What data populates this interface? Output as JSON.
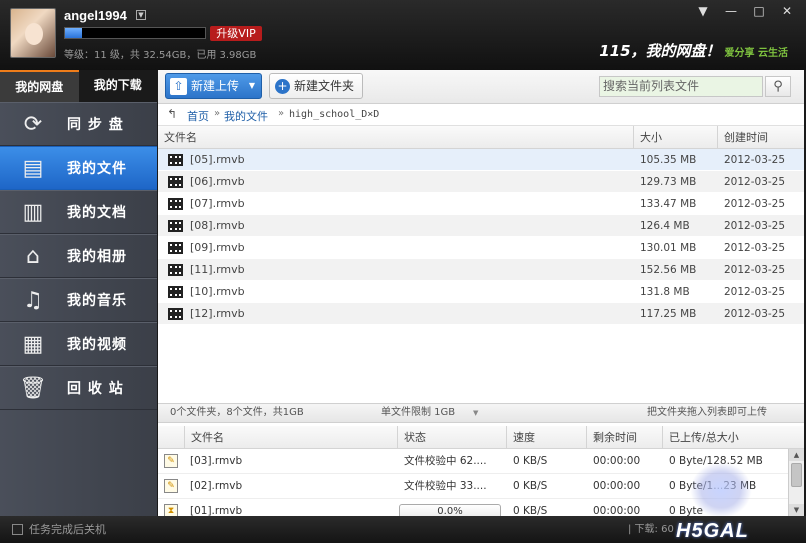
{
  "user": {
    "name": "angel1994",
    "quota_fraction": 0.12,
    "vip_label": "升级VIP",
    "level_info": "等级：11 级，共 32.54GB，已用 3.98GB"
  },
  "brand": {
    "logo": "115，我的网盘！",
    "slogan": "爱分享 云生活"
  },
  "window_controls": {
    "menu": "▼",
    "minimize": "—",
    "maximize": "□",
    "close": "✕"
  },
  "nav_tabs": [
    "我的网盘",
    "我的下载"
  ],
  "sidebar": {
    "items": [
      {
        "label": "同 步 盘",
        "icon": "sync-icon",
        "glyph": "⟳"
      },
      {
        "label": "我的文件",
        "icon": "briefcase-icon",
        "glyph": "▤"
      },
      {
        "label": "我的文档",
        "icon": "document-icon",
        "glyph": "▥"
      },
      {
        "label": "我的相册",
        "icon": "photo-album-icon",
        "glyph": "⌂"
      },
      {
        "label": "我的音乐",
        "icon": "music-note-icon",
        "glyph": "♫"
      },
      {
        "label": "我的视频",
        "icon": "film-icon",
        "glyph": "▦"
      },
      {
        "label": "回 收 站",
        "icon": "trash-icon",
        "glyph": "🗑"
      }
    ],
    "active_index": 1
  },
  "toolbar": {
    "upload_label": "新建上传",
    "newfolder_label": "新建文件夹",
    "search_placeholder": "搜索当前列表文件"
  },
  "breadcrumb": {
    "back": "↰",
    "home": "首页",
    "sep": "»",
    "parent": "我的文件",
    "current": "high_school_D×D"
  },
  "file_columns": {
    "name": "文件名",
    "size": "大小",
    "date": "创建时间"
  },
  "files": [
    {
      "name": "[05].rmvb",
      "size": "105.35 MB",
      "date": "2012-03-25"
    },
    {
      "name": "[06].rmvb",
      "size": "129.73 MB",
      "date": "2012-03-25"
    },
    {
      "name": "[07].rmvb",
      "size": "133.47 MB",
      "date": "2012-03-25"
    },
    {
      "name": "[08].rmvb",
      "size": "126.4 MB",
      "date": "2012-03-25"
    },
    {
      "name": "[09].rmvb",
      "size": "130.01 MB",
      "date": "2012-03-25"
    },
    {
      "name": "[11].rmvb",
      "size": "152.56 MB",
      "date": "2012-03-25"
    },
    {
      "name": "[10].rmvb",
      "size": "131.8 MB",
      "date": "2012-03-25"
    },
    {
      "name": "[12].rmvb",
      "size": "117.25 MB",
      "date": "2012-03-25"
    }
  ],
  "status": {
    "counts": "0个文件夹，8个文件，共1GB",
    "limit": "单文件限制 1GB",
    "hint": "把文件夹拖入列表即可上传"
  },
  "task_columns": {
    "name": "文件名",
    "status": "状态",
    "speed": "速度",
    "remaining": "剩余时间",
    "uploaded": "已上传/总大小"
  },
  "tasks": [
    {
      "name": "[03].rmvb",
      "status": "文件校验中 62....",
      "speed": "0 KB/S",
      "remaining": "00:00:00",
      "uploaded": "0 Byte/128.52 MB"
    },
    {
      "name": "[02].rmvb",
      "status": "文件校验中 33....",
      "speed": "0 KB/S",
      "remaining": "00:00:00",
      "uploaded": "0 Byte/1...23 MB"
    },
    {
      "name": "[01].rmvb",
      "status": "0.0%",
      "progress": 0.0,
      "speed": "0 KB/S",
      "remaining": "00:00:00",
      "uploaded": "0 Byte"
    }
  ],
  "footer": {
    "shutdown_label": "任务完成后关机",
    "speed_label": "| 下载: 60",
    "watermark": "H5GAL"
  }
}
